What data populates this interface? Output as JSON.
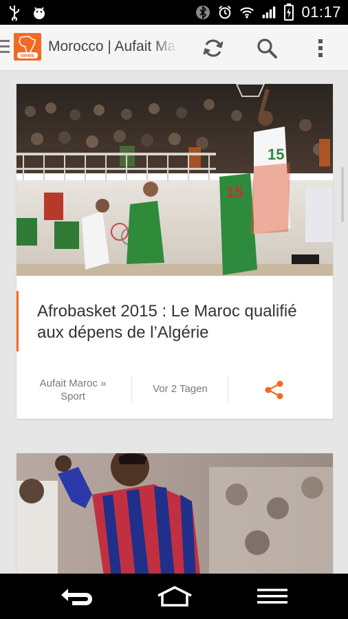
{
  "status_bar": {
    "time": "01:17",
    "icons": [
      "usb-icon",
      "android-debug-icon",
      "bluetooth-icon",
      "alarm-icon",
      "wifi-icon",
      "signal-icon",
      "battery-charging-icon"
    ]
  },
  "app_bar": {
    "title": "Morocco | Aufait Maroc",
    "logo_text": "news",
    "actions": [
      "refresh-icon",
      "search-icon",
      "overflow-menu-icon"
    ]
  },
  "articles": [
    {
      "headline": "Afrobasket 2015 : Le Maroc qualifié aux dépens de l’Algérie",
      "source": "Aufait Maroc » Sport",
      "time": "Vor 2 Tagen",
      "jersey_numbers": [
        "15",
        "15"
      ]
    },
    {
      "headline": "",
      "source": "",
      "time": ""
    }
  ],
  "nav_bar": {
    "buttons": [
      "back-icon",
      "home-icon",
      "menu-icon"
    ]
  },
  "colors": {
    "accent": "#f26a21",
    "status_bar": "#000000",
    "app_bar": "#f5f5f5",
    "background": "#e6e6e6"
  }
}
